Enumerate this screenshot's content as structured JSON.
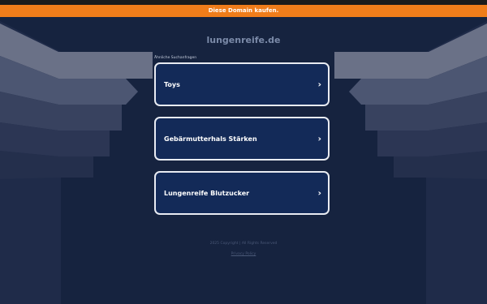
{
  "banner": {
    "text": "Diese Domain kaufen."
  },
  "domain": "lungenreife.de",
  "related_heading": "Ähnliche Suchanfragen",
  "cards": [
    {
      "label": "Toys",
      "chevron": "›"
    },
    {
      "label": "Gebärmutterhals Stärken",
      "chevron": "›"
    },
    {
      "label": "Lungenreife Blutzucker",
      "chevron": "›"
    }
  ],
  "footer": {
    "copyright": "2025 Copyright | All Rights Reserved",
    "privacy": "Privacy Policy"
  },
  "colors": {
    "banner": "#f07d1a",
    "background": "#16233f",
    "card": "#132a58",
    "card_border": "#e8ebf2"
  }
}
